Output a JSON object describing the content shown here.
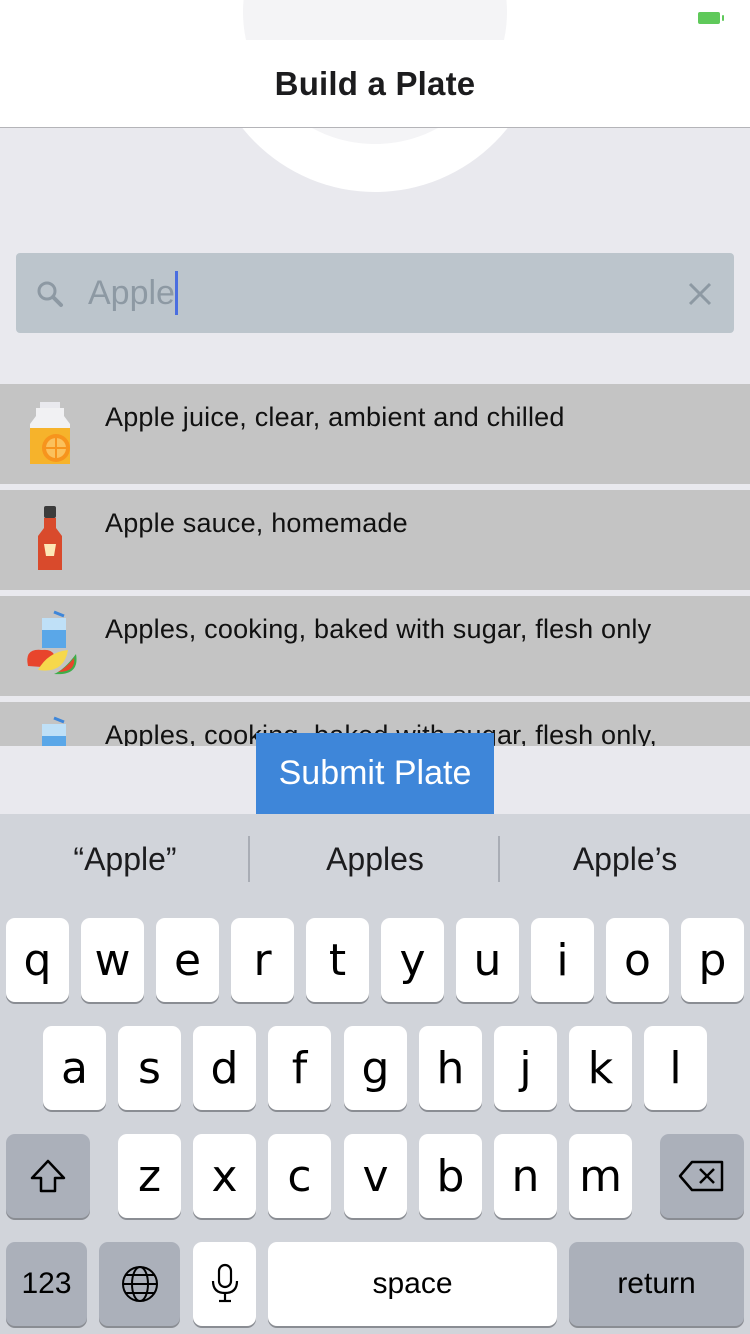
{
  "nav": {
    "title": "Build a Plate"
  },
  "search": {
    "value": "Apple"
  },
  "results": [
    {
      "label": "Apple juice, clear, ambient and chilled",
      "icon": "juice-icon"
    },
    {
      "label": "Apple sauce, homemade",
      "icon": "sauce-bottle-icon"
    },
    {
      "label": "Apples, cooking, baked with sugar, flesh only",
      "icon": "fruit-drink-icon"
    },
    {
      "label": "Apples, cooking, baked with sugar, flesh only,",
      "icon": "fruit-drink-icon"
    }
  ],
  "submit_label": "Submit Plate",
  "keyboard": {
    "suggestions": [
      "“Apple”",
      "Apples",
      "Apple’s"
    ],
    "row1": [
      "q",
      "w",
      "e",
      "r",
      "t",
      "y",
      "u",
      "i",
      "o",
      "p"
    ],
    "row2": [
      "a",
      "s",
      "d",
      "f",
      "g",
      "h",
      "j",
      "k",
      "l"
    ],
    "row3": [
      "z",
      "x",
      "c",
      "v",
      "b",
      "n",
      "m"
    ],
    "numbers_label": "123",
    "space_label": "space",
    "return_label": "return"
  },
  "colors": {
    "accent": "#3e86d9",
    "search_bg": "#bcc5cc",
    "row_bg": "#c4c4c4",
    "battery": "#5fc95a"
  }
}
